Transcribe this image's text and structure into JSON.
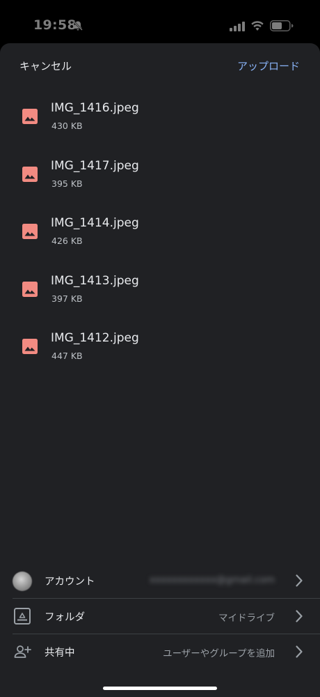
{
  "status_bar": {
    "time": "19:58",
    "icons": [
      "bell-slash-icon",
      "signal-icon",
      "wifi-icon",
      "battery-icon"
    ]
  },
  "header": {
    "cancel_label": "キャンセル",
    "upload_label": "アップロード"
  },
  "files": [
    {
      "name": "IMG_1416.jpeg",
      "size": "430 KB",
      "icon": "image-icon"
    },
    {
      "name": "IMG_1417.jpeg",
      "size": "395 KB",
      "icon": "image-icon"
    },
    {
      "name": "IMG_1414.jpeg",
      "size": "426 KB",
      "icon": "image-icon"
    },
    {
      "name": "IMG_1413.jpeg",
      "size": "397 KB",
      "icon": "image-icon"
    },
    {
      "name": "IMG_1412.jpeg",
      "size": "447 KB",
      "icon": "image-icon"
    }
  ],
  "settings": {
    "account": {
      "label": "アカウント",
      "value": "xxxxxxxxxxxx@gmail.com"
    },
    "folder": {
      "label": "フォルダ",
      "value": "マイドライブ"
    },
    "sharing": {
      "label": "共有中",
      "value": "ユーザーやグループを追加"
    }
  },
  "colors": {
    "accent": "#8ab4f8",
    "file_icon": "#f28b82",
    "sheet_bg": "#202124"
  }
}
